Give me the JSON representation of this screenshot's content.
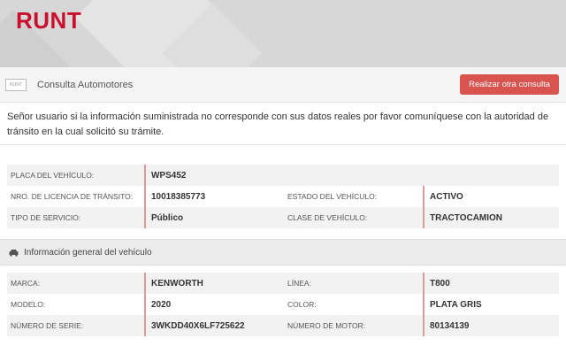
{
  "brand": {
    "logo_text": "RUNT",
    "mini_logo_text": "RUNT"
  },
  "toolbar": {
    "title": "Consulta Automotores",
    "action_label": "Realizar otra consulta"
  },
  "notice": "Señor usuario si la información suministrada no corresponde con sus datos reales por favor comuníquese con la autoridad de tránsito en la cual solicitó su trámite.",
  "vehicle": {
    "placa_label": "PLACA DEL VEHÍCULO:",
    "placa_value": "WPS452",
    "licencia_label": "NRO. DE LICENCIA DE TRÁNSITO:",
    "licencia_value": "10018385773",
    "estado_label": "ESTADO DEL VEHÍCULO:",
    "estado_value": "ACTIVO",
    "servicio_label": "TIPO DE SERVICIO:",
    "servicio_value": "Público",
    "clase_label": "CLASE DE VEHÍCULO:",
    "clase_value": "TRACTOCAMION"
  },
  "general": {
    "title": "Información general del vehículo",
    "marca_label": "MARCA:",
    "marca_value": "KENWORTH",
    "linea_label": "LÍNEA:",
    "linea_value": "T800",
    "modelo_label": "MODELO:",
    "modelo_value": "2020",
    "color_label": "COLOR:",
    "color_value": "PLATA GRIS",
    "serie_label": "NÚMERO DE SERIE:",
    "serie_value": "3WKDD40X6LF725622",
    "motor_label": "NÚMERO DE MOTOR:",
    "motor_value": "80134139"
  },
  "colors": {
    "brand_red": "#c8102e",
    "button_red": "#d9534f"
  }
}
